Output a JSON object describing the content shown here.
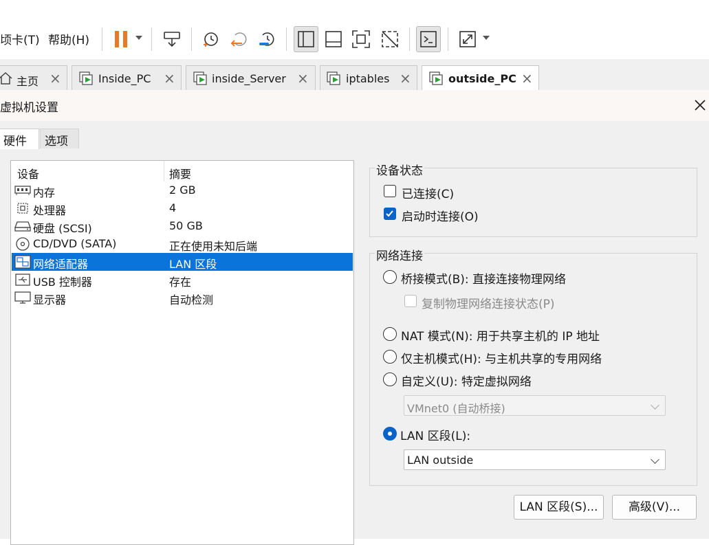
{
  "menu": {
    "items": [
      "顷卡(T)",
      "帮助(H)"
    ]
  },
  "tabs": [
    {
      "label": "主页",
      "icon": "home-icon"
    },
    {
      "label": "Inside_PC",
      "icon": "vm-icon"
    },
    {
      "label": "inside_Server",
      "icon": "vm-icon"
    },
    {
      "label": "iptables",
      "icon": "vm-icon"
    },
    {
      "label": "outside_PC",
      "icon": "vm-icon",
      "active": true
    }
  ],
  "dialog": {
    "title": "虚拟机设置",
    "settings_tabs": [
      "硬件",
      "选项"
    ]
  },
  "device_list": {
    "headers": {
      "device": "设备",
      "summary": "摘要"
    },
    "rows": [
      {
        "name": "内存",
        "summary": "2 GB",
        "icon": "memory-icon"
      },
      {
        "name": "处理器",
        "summary": "4",
        "icon": "cpu-icon"
      },
      {
        "name": "硬盘 (SCSI)",
        "summary": "50 GB",
        "icon": "hard-disk-icon"
      },
      {
        "name": "CD/DVD (SATA)",
        "summary": "正在使用未知后端",
        "icon": "cd-dvd-icon"
      },
      {
        "name": "网络适配器",
        "summary": "LAN 区段",
        "icon": "network-adapter-icon",
        "selected": true
      },
      {
        "name": "USB 控制器",
        "summary": "存在",
        "icon": "usb-icon"
      },
      {
        "name": "显示器",
        "summary": "自动检测",
        "icon": "monitor-icon"
      }
    ]
  },
  "device_status": {
    "title": "设备状态",
    "connected": {
      "label": "已连接(C)",
      "checked": false
    },
    "connect_on_power": {
      "label": "启动时连接(O)",
      "checked": true
    }
  },
  "network": {
    "title": "网络连接",
    "bridged": "桥接模式(B): 直接连接物理网络",
    "replicate": "复制物理网络连接状态(P)",
    "nat": "NAT 模式(N): 用于共享主机的 IP 地址",
    "host_only": "仅主机模式(H): 与主机共享的专用网络",
    "custom": "自定义(U): 特定虚拟网络",
    "custom_value": "VMnet0 (自动桥接)",
    "lan": "LAN 区段(L):",
    "lan_value": "LAN outside",
    "selected": "lan"
  },
  "buttons": {
    "lan_segments": "LAN 区段(S)...",
    "advanced": "高级(V)..."
  },
  "colors": {
    "accent": "#0a74da",
    "pause": "#e8792b"
  }
}
